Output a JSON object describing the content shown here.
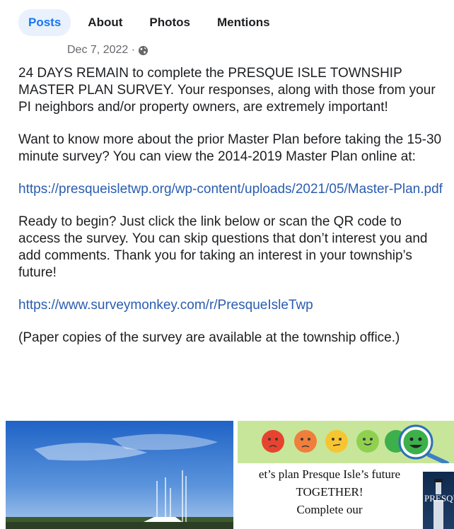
{
  "tabs": [
    {
      "label": "Posts",
      "active": true
    },
    {
      "label": "About",
      "active": false
    },
    {
      "label": "Photos",
      "active": false
    },
    {
      "label": "Mentions",
      "active": false
    }
  ],
  "post": {
    "date": "Dec 7, 2022 · ",
    "audience_icon": "globe-icon",
    "paragraph1": "24 DAYS REMAIN to complete the PRESQUE ISLE TOWNSHIP MASTER PLAN SURVEY. Your responses, along with those from your PI neighbors and/or property owners, are extremely important!",
    "paragraph2": "Want to know more about the prior Master Plan before taking the 15-30 minute survey? You can view the 2014-2019 Master Plan online at:",
    "link1": "https://presqueisletwp.org/wp-content/uploads/2021/05/Master-Plan.pdf",
    "paragraph3": "Ready to begin? Just click the link below or scan the QR code to access the survey. You can skip questions that don’t interest you and add comments. Thank you for taking an interest in your township’s future!",
    "link2": "https://www.surveymonkey.com/r/PresqueIsleTwp",
    "paragraph4": "(Paper copies of the survey are available at the township office.)"
  },
  "photos": {
    "left_image": "harbor-photo",
    "right_flyer": {
      "line1": "et’s plan Presque Isle’s future",
      "line2": "TOGETHER!",
      "line3": "Complete our",
      "poster_text": "PRESQUE"
    },
    "emoji_colors": [
      "#e8432f",
      "#f07f3c",
      "#f7c531",
      "#8fd14f",
      "#3db04b"
    ],
    "magnifier_icon": "magnifier-icon",
    "link_color": "#2a5db0",
    "accent": "#1877f2"
  }
}
